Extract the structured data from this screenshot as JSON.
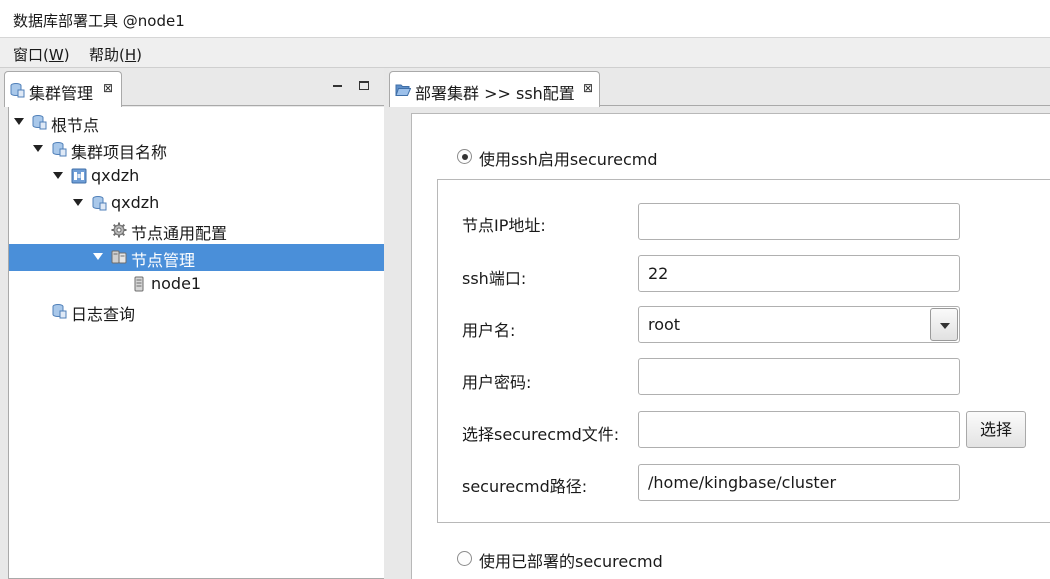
{
  "window": {
    "title": "数据库部署工具 @node1"
  },
  "menu": [
    {
      "label": "窗口(",
      "mnemonic": "W",
      "tail": ")"
    },
    {
      "label": "帮助(",
      "mnemonic": "H",
      "tail": ")"
    }
  ],
  "left_view": {
    "tab_label": "集群管理",
    "tab_close": "⊠",
    "tree": [
      {
        "label": "根节点"
      },
      {
        "label": "集群项目名称"
      },
      {
        "label": "qxdzh"
      },
      {
        "label": "qxdzh"
      },
      {
        "label": "节点通用配置"
      },
      {
        "label": "节点管理",
        "selected": true
      },
      {
        "label": "node1"
      },
      {
        "label": "日志查询"
      }
    ]
  },
  "editor": {
    "tab_label": "部署集群 >> ssh配置",
    "tab_close": "⊠",
    "radio_ssh": {
      "label": "使用ssh启用securecmd",
      "checked": true
    },
    "radio_deployed": {
      "label": "使用已部署的securecmd",
      "checked": false
    },
    "fields": {
      "ip": {
        "label": "节点IP地址:",
        "value": ""
      },
      "port": {
        "label": "ssh端口:",
        "value": "22"
      },
      "user": {
        "label": "用户名:",
        "value": "root"
      },
      "password": {
        "label": "用户密码:",
        "value": ""
      },
      "file": {
        "label": "选择securecmd文件:",
        "value": "",
        "button": "选择"
      },
      "path": {
        "label": "securecmd路径:",
        "value": "/home/kingbase/cluster"
      }
    }
  },
  "colors": {
    "selection": "#4a8fd9",
    "icon_db": "#7aa7d8"
  }
}
